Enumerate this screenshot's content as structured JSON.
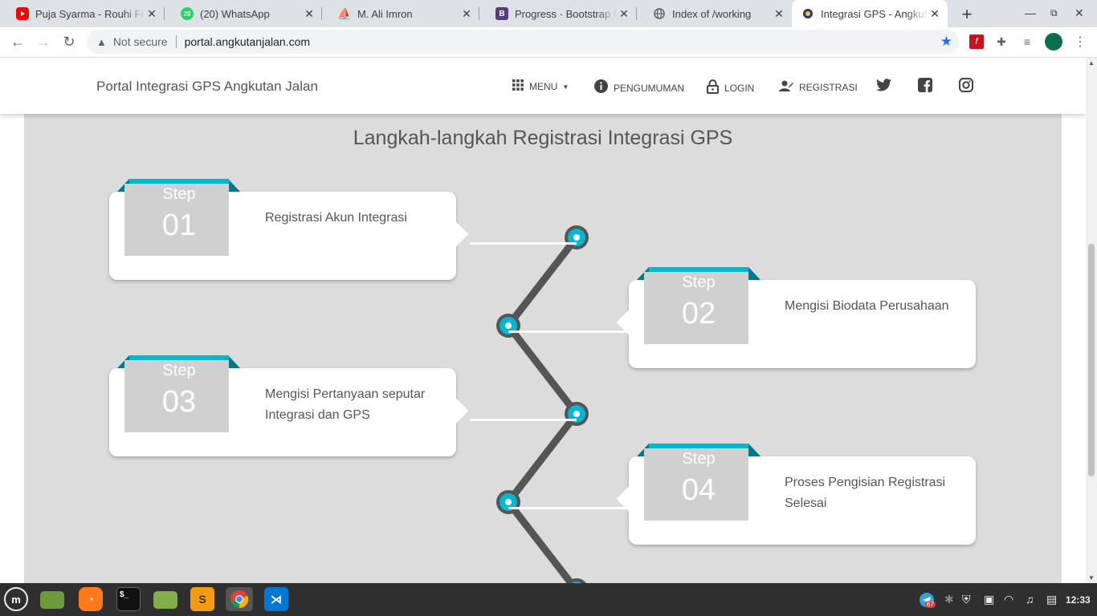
{
  "browser": {
    "tabs": [
      {
        "title": "Puja Syarma - Rouhi Fi",
        "favicon": "youtube-icon",
        "color": "#ff0000"
      },
      {
        "title": "(20) WhatsApp",
        "favicon": "whatsapp-icon",
        "badge": "20",
        "color": "#25d366"
      },
      {
        "title": "M. Ali Imron",
        "favicon": "document-icon",
        "color": "#3c4043"
      },
      {
        "title": "Progress · Bootstrap v",
        "favicon": "bootstrap-icon",
        "badge": "B",
        "color": "#563d7c"
      },
      {
        "title": "Index of /working",
        "favicon": "globe-icon",
        "color": "#5f6368"
      },
      {
        "title": "Integrasi GPS - Angkut",
        "favicon": "site-logo-icon",
        "color": "#3c4043",
        "active": true
      }
    ],
    "security_label": "Not secure",
    "url": "portal.angkutanjalan.com"
  },
  "site": {
    "brand": "Portal Integrasi GPS Angkutan Jalan",
    "nav": {
      "menu": "MENU",
      "announcements": "PENGUMUMAN",
      "login": "LOGIN",
      "register": "REGISTRASI"
    }
  },
  "section": {
    "title": "Langkah-langkah Registrasi Integrasi GPS",
    "step_label": "Step",
    "steps": [
      {
        "number": "01",
        "text": "Registrasi Akun Integrasi"
      },
      {
        "number": "02",
        "text": "Mengisi Biodata Perusahaan"
      },
      {
        "number": "03",
        "text": "Mengisi Pertanyaan seputar Integrasi dan GPS"
      },
      {
        "number": "04",
        "text": "Proses Pengisian Registrasi Selesai"
      }
    ]
  },
  "colors": {
    "accent": "#00b8d4",
    "accent_dark": "#007a8a",
    "line": "#555555",
    "panel": "#dcdcdc"
  },
  "taskbar": {
    "clock": "12:33",
    "notification_count": "67",
    "apps": [
      "mint-menu-icon",
      "files-icon",
      "firefox-icon",
      "terminal-icon",
      "folder-icon",
      "sublime-icon",
      "chrome-icon",
      "vscode-icon"
    ]
  }
}
